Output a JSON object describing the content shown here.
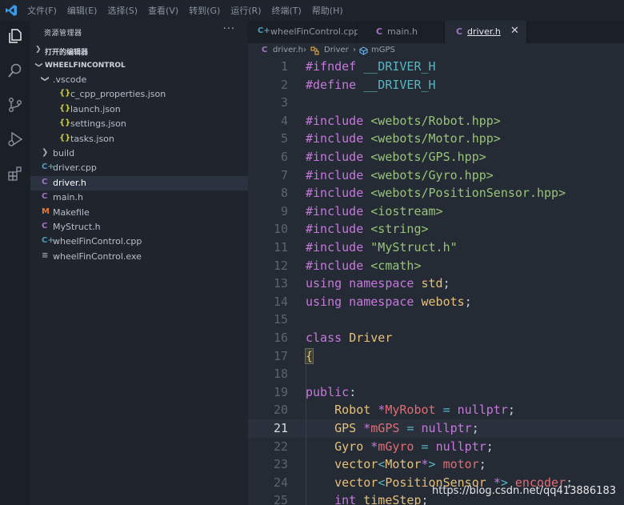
{
  "menu": [
    "文件(F)",
    "编辑(E)",
    "选择(S)",
    "查看(V)",
    "转到(G)",
    "运行(R)",
    "终端(T)",
    "帮助(H)"
  ],
  "explorer": {
    "title": "资源管理器",
    "more": "···",
    "open_editors": "打开的编辑器",
    "project": "WHEELFINCONTROL",
    "items": [
      {
        "name": ".vscode",
        "icon": "chevron-down",
        "indent": 1,
        "type": "folder"
      },
      {
        "name": "c_cpp_properties.json",
        "icon": "{}",
        "indent": 2,
        "type": "json"
      },
      {
        "name": "launch.json",
        "icon": "{}",
        "indent": 2,
        "type": "json"
      },
      {
        "name": "settings.json",
        "icon": "{}",
        "indent": 2,
        "type": "json"
      },
      {
        "name": "tasks.json",
        "icon": "{}",
        "indent": 2,
        "type": "json"
      },
      {
        "name": "build",
        "icon": "chevron-right",
        "indent": 1,
        "type": "folder"
      },
      {
        "name": "driver.cpp",
        "icon": "C+",
        "indent": 1,
        "type": "cpp"
      },
      {
        "name": "driver.h",
        "icon": "C",
        "indent": 1,
        "type": "h",
        "active": true
      },
      {
        "name": "main.h",
        "icon": "C",
        "indent": 1,
        "type": "h"
      },
      {
        "name": "Makefile",
        "icon": "M",
        "indent": 1,
        "type": "make"
      },
      {
        "name": "MyStruct.h",
        "icon": "C",
        "indent": 1,
        "type": "h"
      },
      {
        "name": "wheelFinControl.cpp",
        "icon": "C+",
        "indent": 1,
        "type": "cpp"
      },
      {
        "name": "wheelFinControl.exe",
        "icon": "≡",
        "indent": 1,
        "type": "exe"
      }
    ]
  },
  "tabs": [
    {
      "label": "wheelFinControl.cpp",
      "icon": "C+"
    },
    {
      "label": "main.h",
      "icon": "C"
    },
    {
      "label": "driver.h",
      "icon": "C",
      "active": true,
      "close": "✕"
    }
  ],
  "breadcrumb": {
    "file": "driver.h",
    "class": "Driver",
    "member": "mGPS"
  },
  "editor": {
    "current_line": 21,
    "lines": [
      {
        "n": "1",
        "t": [
          [
            "kw",
            "#ifndef "
          ],
          [
            "op",
            "__DRIVER_H"
          ]
        ]
      },
      {
        "n": "2",
        "t": [
          [
            "kw",
            "#define "
          ],
          [
            "op",
            "__DRIVER_H"
          ]
        ]
      },
      {
        "n": "3",
        "t": []
      },
      {
        "n": "4",
        "t": [
          [
            "kw",
            "#include "
          ],
          [
            "st",
            "<webots/Robot.hpp>"
          ]
        ]
      },
      {
        "n": "5",
        "t": [
          [
            "kw",
            "#include "
          ],
          [
            "st",
            "<webots/Motor.hpp>"
          ]
        ]
      },
      {
        "n": "6",
        "t": [
          [
            "kw",
            "#include "
          ],
          [
            "st",
            "<webots/GPS.hpp>"
          ]
        ]
      },
      {
        "n": "7",
        "t": [
          [
            "kw",
            "#include "
          ],
          [
            "st",
            "<webots/Gyro.hpp>"
          ]
        ]
      },
      {
        "n": "8",
        "t": [
          [
            "kw",
            "#include "
          ],
          [
            "st",
            "<webots/PositionSensor.hpp>"
          ]
        ]
      },
      {
        "n": "9",
        "t": [
          [
            "kw",
            "#include "
          ],
          [
            "st",
            "<iostream>"
          ]
        ]
      },
      {
        "n": "10",
        "t": [
          [
            "kw",
            "#include "
          ],
          [
            "st",
            "<string>"
          ]
        ]
      },
      {
        "n": "11",
        "t": [
          [
            "kw",
            "#include "
          ],
          [
            "st",
            "\"MyStruct.h\""
          ]
        ]
      },
      {
        "n": "12",
        "t": [
          [
            "kw",
            "#include "
          ],
          [
            "st",
            "<cmath>"
          ]
        ]
      },
      {
        "n": "13",
        "t": [
          [
            "kw",
            "using namespace "
          ],
          [
            "ty",
            "std"
          ],
          [
            "pl",
            ";"
          ]
        ]
      },
      {
        "n": "14",
        "t": [
          [
            "kw",
            "using namespace "
          ],
          [
            "ty",
            "webots"
          ],
          [
            "pl",
            ";"
          ]
        ]
      },
      {
        "n": "15",
        "t": []
      },
      {
        "n": "16",
        "t": [
          [
            "kw",
            "class "
          ],
          [
            "ty",
            "Driver"
          ]
        ]
      },
      {
        "n": "17",
        "t": [
          [
            "brace",
            "{"
          ]
        ]
      },
      {
        "n": "18",
        "t": []
      },
      {
        "n": "19",
        "t": [
          [
            "kw",
            "public"
          ],
          [
            "pl",
            ":"
          ]
        ]
      },
      {
        "n": "20",
        "t": [
          [
            "pl",
            "    "
          ],
          [
            "ty",
            "Robot "
          ],
          [
            "kw",
            "*"
          ],
          [
            "vr",
            "MyRobot"
          ],
          [
            "pl",
            " "
          ],
          [
            "op",
            "="
          ],
          [
            "pl",
            " "
          ],
          [
            "kw",
            "nullptr"
          ],
          [
            "pl",
            ";"
          ]
        ]
      },
      {
        "n": "21",
        "t": [
          [
            "pl",
            "    "
          ],
          [
            "ty",
            "GPS "
          ],
          [
            "kw",
            "*"
          ],
          [
            "vr",
            "mGPS"
          ],
          [
            "pl",
            " "
          ],
          [
            "op",
            "="
          ],
          [
            "pl",
            " "
          ],
          [
            "kw",
            "nullptr"
          ],
          [
            "pl",
            ";"
          ]
        ]
      },
      {
        "n": "22",
        "t": [
          [
            "pl",
            "    "
          ],
          [
            "ty",
            "Gyro "
          ],
          [
            "kw",
            "*"
          ],
          [
            "vr",
            "mGyro"
          ],
          [
            "pl",
            " "
          ],
          [
            "op",
            "="
          ],
          [
            "pl",
            " "
          ],
          [
            "kw",
            "nullptr"
          ],
          [
            "pl",
            ";"
          ]
        ]
      },
      {
        "n": "23",
        "t": [
          [
            "pl",
            "    "
          ],
          [
            "ty",
            "vector"
          ],
          [
            "op",
            "<"
          ],
          [
            "ty",
            "Motor"
          ],
          [
            "kw",
            "*"
          ],
          [
            "op",
            ">"
          ],
          [
            "pl",
            " "
          ],
          [
            "vr",
            "motor"
          ],
          [
            "pl",
            ";"
          ]
        ]
      },
      {
        "n": "24",
        "t": [
          [
            "pl",
            "    "
          ],
          [
            "ty",
            "vector"
          ],
          [
            "op",
            "<"
          ],
          [
            "ty",
            "PositionSensor "
          ],
          [
            "kw",
            "*"
          ],
          [
            "op",
            ">"
          ],
          [
            "pl",
            " "
          ],
          [
            "vr",
            "encoder"
          ],
          [
            "pl",
            ";"
          ]
        ]
      },
      {
        "n": "25",
        "t": [
          [
            "pl",
            "    "
          ],
          [
            "kw",
            "int "
          ],
          [
            "ty",
            "timeStep"
          ],
          [
            "pl",
            ";"
          ]
        ]
      }
    ]
  },
  "watermark": "https://blog.csdn.net/qq413886183"
}
